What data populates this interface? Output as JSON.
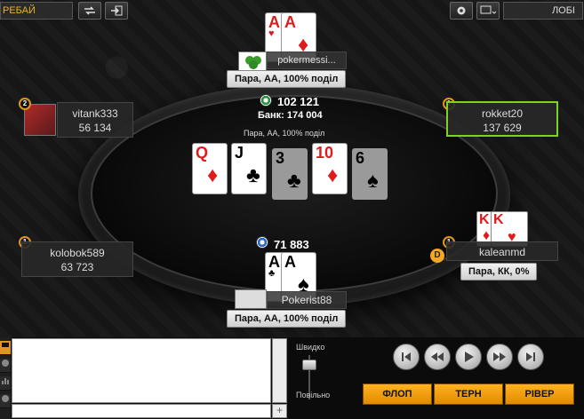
{
  "topbar": {
    "replay_label": "РЕБАЙ",
    "lobby_label": "ЛОБІ",
    "refresh_icon": "refresh-icon",
    "exit_icon": "exit-icon",
    "settings_icon": "gear-icon",
    "layout_icon": "window-layout-icon"
  },
  "pot": {
    "amount": "102 121",
    "total": "Банк: 174 004",
    "hand_description": "Пара, АА, 100% поділ"
  },
  "board": [
    {
      "rank": "Q",
      "suit": "♦",
      "color": "red"
    },
    {
      "rank": "J",
      "suit": "♣",
      "color": "black"
    },
    {
      "rank": "3",
      "suit": "♣",
      "color": "black"
    },
    {
      "rank": "10",
      "suit": "♦",
      "color": "red"
    },
    {
      "rank": "6",
      "suit": "♠",
      "color": "black"
    }
  ],
  "players": {
    "top": {
      "name": "pokermessi...",
      "hand_result": "Пара, АА, 100% поділ",
      "cards": [
        {
          "rank": "A",
          "suit": "♥"
        },
        {
          "rank": "A",
          "suit": "♦"
        }
      ]
    },
    "left_top": {
      "seat": "2",
      "name": "vitank333",
      "stack": "56 134"
    },
    "right_top": {
      "seat": "1",
      "name": "rokket20",
      "stack": "137 629"
    },
    "left_bottom": {
      "seat": "1",
      "name": "kolobok589",
      "stack": "63 723"
    },
    "right_bottom": {
      "seat": "1",
      "name": "kaleanmd",
      "dealer": "D",
      "hand_result": "Пара, КК, 0%",
      "cards": [
        {
          "rank": "K",
          "suit": "♦"
        },
        {
          "rank": "K",
          "suit": "♥"
        }
      ]
    },
    "bottom": {
      "name": "Pokerist88",
      "bet": "71 883",
      "hand_result": "Пара, АА, 100% поділ",
      "cards": [
        {
          "rank": "A",
          "suit": "♣"
        },
        {
          "rank": "A",
          "suit": "♠"
        }
      ]
    }
  },
  "bottom_panel": {
    "speed_fast": "Швидко",
    "speed_slow": "Повільно",
    "streets": [
      "ФЛОП",
      "ТЕРН",
      "РІВЕР"
    ],
    "controls": [
      "skip-start-icon",
      "rewind-icon",
      "play-icon",
      "fast-forward-icon",
      "skip-end-icon"
    ],
    "send_label": "+"
  },
  "colors": {
    "accent": "#e0951e",
    "active_border": "#7ed321",
    "street_button": "#ffa500"
  }
}
